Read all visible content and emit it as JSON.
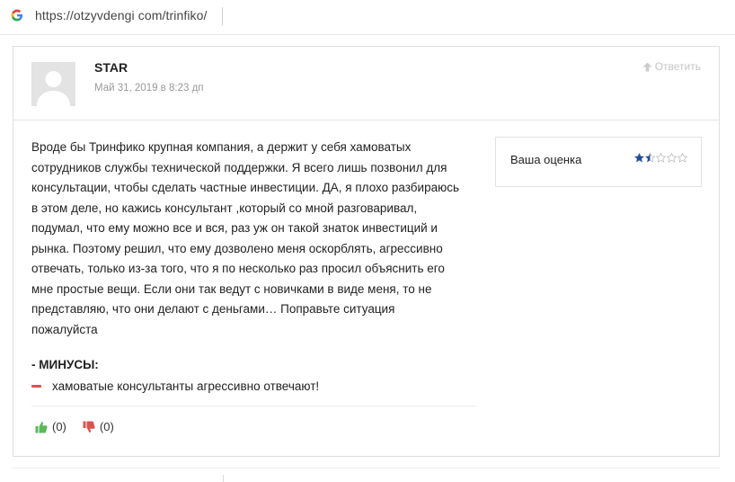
{
  "browser": {
    "url": "https://otzyvdengi com/trinfiko/"
  },
  "comment": {
    "author": "STAR",
    "date": "Май 31, 2019 в 8:23 дп",
    "reply_label": "Ответить",
    "text": "Вроде бы Тринфико крупная компания, а держит у себя хамоватых\nсотрудников службы технической поддержки. Я всего лишь позвонил для\nконсультации, чтобы сделать частные инвестиции. ДА, я плохо разбираюсь\nв этом деле, но кажись консультант ,который со мной разговаривал,\nподумал, что ему можно все и вся, раз уж он такой знаток инвестиций и\nрынка. Поэтому решил, что ему дозволено меня оскорблять, агрессивно\nотвечать, только из-за того, что я по несколько раз просил объяснить его\nмне простые вещи. Если они так ведут с новичками в виде меня, то не\nпредставляю, что они делают с деньгами… Поправьте ситуация\nпожалуйста",
    "rating": {
      "label": "Ваша оценка",
      "value": 1.5,
      "max": 5,
      "star_color": "#1e4e9c"
    },
    "minus": {
      "title": "- МИНУСЫ:",
      "items": [
        "хамоватые консультанты агрессивно отвечают!"
      ],
      "dash_color": "#d9534f"
    },
    "votes": {
      "up": "(0)",
      "down": "(0)",
      "up_color": "#5cb85c",
      "down_color": "#d9534f"
    }
  }
}
